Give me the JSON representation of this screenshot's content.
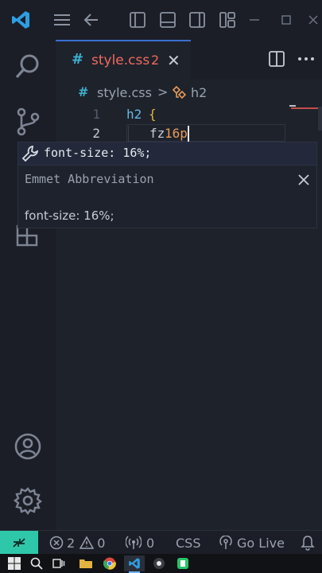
{
  "colors": {
    "accent": "#3a6fd1",
    "error": "#f06b5f",
    "remote": "#2fc7a9",
    "selector": "#66b8e8",
    "brace": "#e3b341",
    "number": "#e69a5a"
  },
  "tab": {
    "hash": "#",
    "filename": "style.css",
    "problem_count": "2",
    "close": "✕"
  },
  "breadcrumb": {
    "hash": "#",
    "file": "style.css",
    "separator": ">",
    "symbol": "h2"
  },
  "code": {
    "lines": [
      {
        "number": "1",
        "selector": "h2",
        "brace": "{"
      },
      {
        "number": "2",
        "text_before": "fz",
        "number_text": "16p"
      }
    ]
  },
  "suggest": {
    "item_label": "font-size: 16%;",
    "details_title": "Emmet Abbreviation",
    "details_body": "font-size: 16%;"
  },
  "statusbar": {
    "errors": "2",
    "warnings": "0",
    "ports": "0",
    "language": "CSS",
    "go_live": "Go Live"
  }
}
